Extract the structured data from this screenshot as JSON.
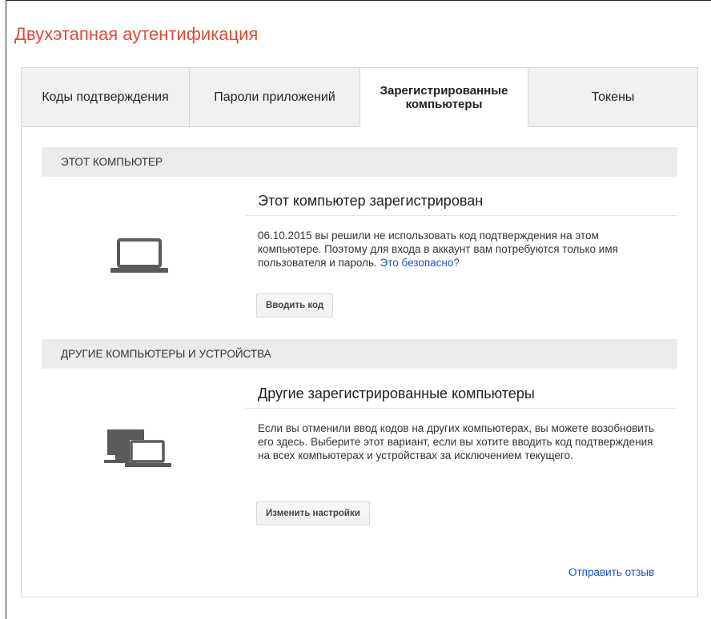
{
  "page": {
    "title": "Двухэтапная аутентификация"
  },
  "tabs": [
    {
      "label": "Коды подтверждения",
      "selected": false
    },
    {
      "label": "Пароли приложений",
      "selected": false
    },
    {
      "label": "Зарегистрированные компьютеры",
      "selected": true
    },
    {
      "label": "Токены",
      "selected": false
    }
  ],
  "this_computer": {
    "header": "ЭТОТ КОМПЬЮТЕР",
    "title": "Этот компьютер зарегистрирован",
    "description": "06.10.2015 вы решили не использовать код подтверждения на этом компьютере. Поэтому для входа в аккаунт вам потребуются только имя пользователя и пароль.",
    "link": "Это безопасно?",
    "button": "Вводить код",
    "icon": "laptop-icon"
  },
  "other_computers": {
    "header": "ДРУГИЕ КОМПЬЮТЕРЫ И УСТРОЙСТВА",
    "title": "Другие зарегистрированные компьютеры",
    "description": "Если вы отменили ввод кодов на других компьютерах, вы можете возобновить его здесь. Выберите этот вариант, если вы хотите вводить код подтверждения на всех компьютерах и устройствах за исключением текущего.",
    "button": "Изменить настройки",
    "icon": "devices-icon"
  },
  "footer": {
    "feedback_link": "Отправить отзыв"
  },
  "colors": {
    "title": "#dd4b39",
    "link": "#1155cc",
    "header_bg": "#ebebeb",
    "icon": "#5a5a5a"
  }
}
